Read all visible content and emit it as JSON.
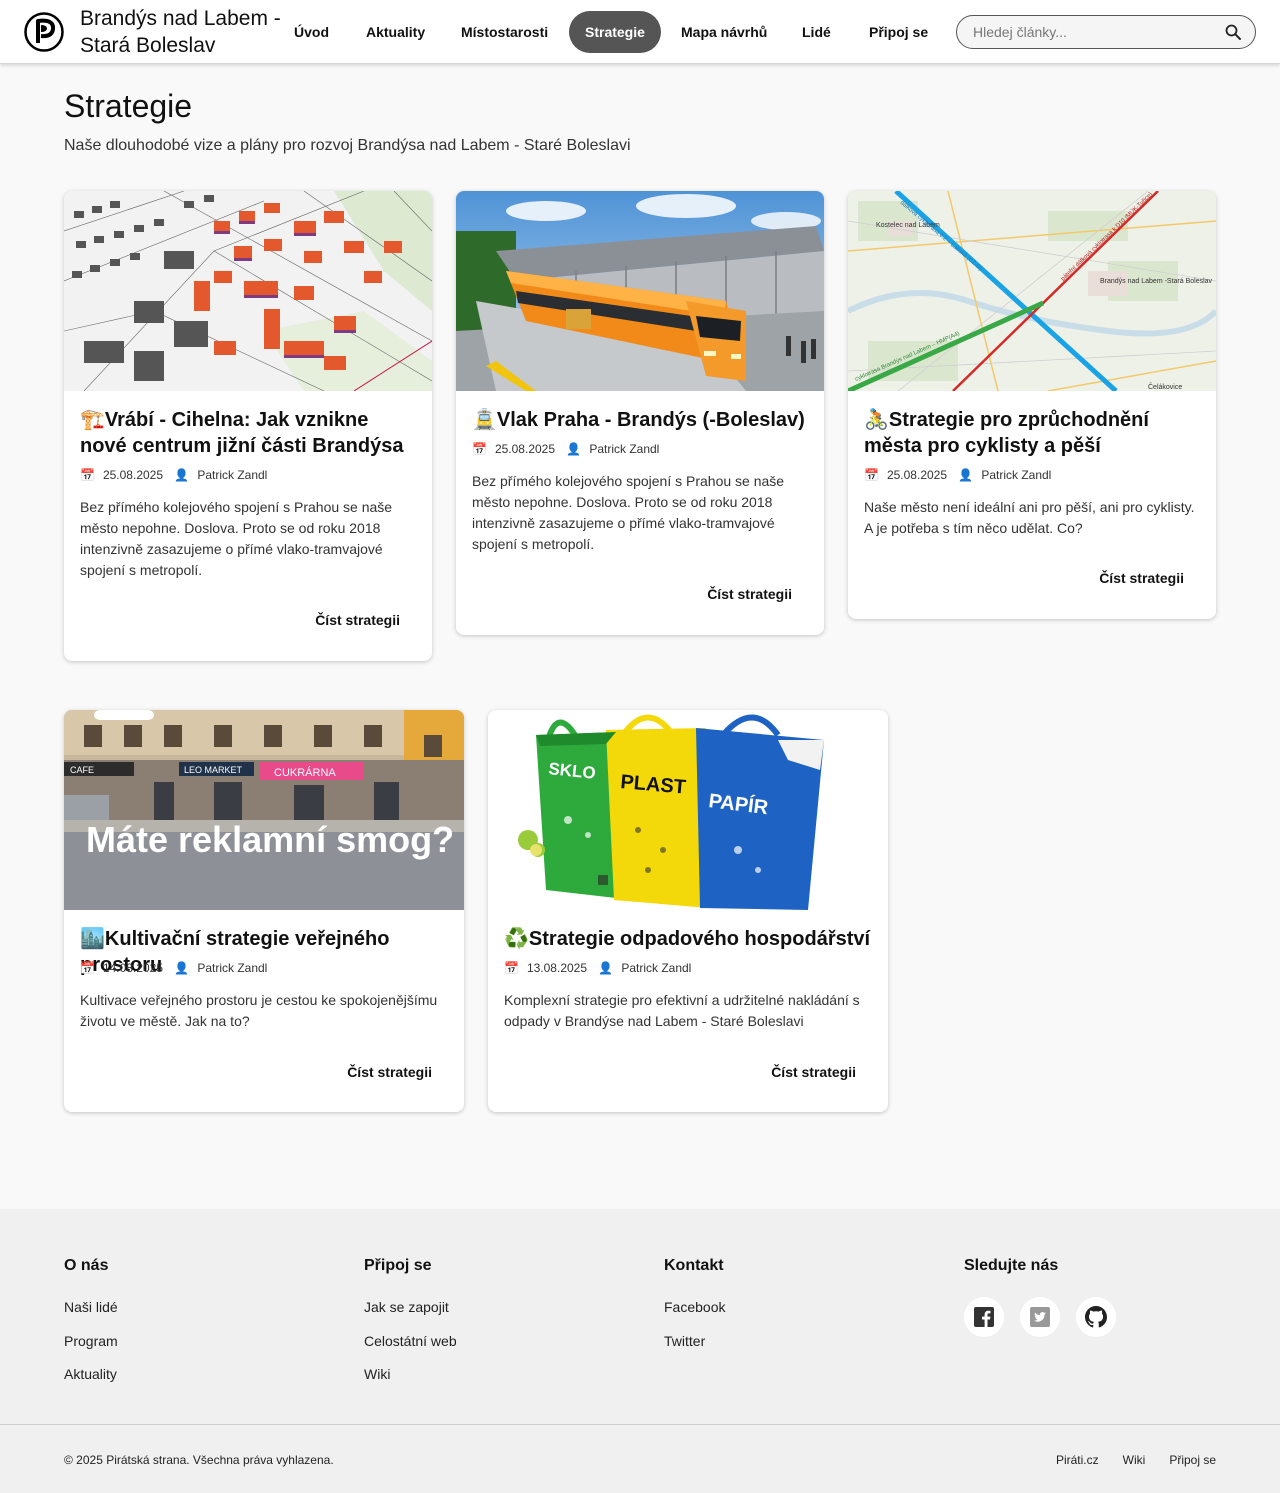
{
  "header": {
    "site_title": "Brandýs nad Labem - Stará Boleslav",
    "nav": [
      {
        "label": "Úvod"
      },
      {
        "label": "Aktuality"
      },
      {
        "label": "Místostarosti"
      },
      {
        "label": "Strategie",
        "active": true
      },
      {
        "label": "Mapa návrhů"
      },
      {
        "label": "Lidé"
      },
      {
        "label": "Připoj se"
      }
    ],
    "search": {
      "placeholder": "Hledej články...",
      "value": ""
    },
    "accent_color": "#555555"
  },
  "page": {
    "title": "Strategie",
    "subtitle": "Naše dlouhodobé vize a plány pro rozvoj Brandýsa nad Labem - Staré Boleslavi"
  },
  "cards": [
    {
      "icon": "🏗️",
      "title": "Vrábí - Cihelna: Jak vznikne nové centrum jižní části Brandýsa",
      "date": "25.08.2025",
      "author": "Patrick Zandl",
      "excerpt": "Bez přímého kolejového spojení s Prahou se naše město nepohne. Doslova. Proto se od roku 2018 intenzivně zasazujeme o přímé vlako-tramvajové spojení s metropolí.",
      "read_label": "Číst strategii",
      "image": "urban-plan-3d-image"
    },
    {
      "icon": "🚊",
      "title": "Vlak Praha - Brandýs (-Boleslav)",
      "date": "25.08.2025",
      "author": "Patrick Zandl",
      "excerpt": "Bez přímého kolejového spojení s Prahou se naše město nepohne. Doslova. Proto se od roku 2018 intenzivně zasazujeme o přímé vlako-tramvajové spojení s metropolí.",
      "read_label": "Číst strategii",
      "image": "train-station-image"
    },
    {
      "icon": "🚴",
      "title": "Strategie pro zprůchodnění města pro cyklisty a pěší",
      "date": "25.08.2025",
      "author": "Patrick Zandl",
      "excerpt": "Naše město není ideální ani pro pěší, ani pro cyklisty. A je potřeba s tím něco udělat. Co?",
      "read_label": "Číst strategii",
      "image": "cycling-map-image",
      "map_labels": [
        "dálková cyklotrasa č.2 – Labská (CZ-D)",
        "páteřní dálková cyklotrasa k D10 (MÚK-Tuřice)",
        "cyklotrasa Brandýs nad Labem – HMP(A4)",
        "Kostelec nad Labem",
        "Brandýs nad Labem -Stará Boleslav",
        "Čelákovice"
      ]
    },
    {
      "icon": "🏙️",
      "title": "Kultivační strategie veřejného prostoru",
      "date": "14.08.2025",
      "author": "Patrick Zandl",
      "excerpt": "Kultivace veřejného prostoru je cestou ke spokojenějšímu životu ve městě. Jak na to?",
      "read_label": "Číst strategii",
      "image": "street-facade-image",
      "overlay": "Máte reklamní smog?",
      "shop_signs": [
        "LEO MARKET",
        "CUKRÁRNA",
        "CAFE"
      ]
    },
    {
      "icon": "♻️",
      "title": "Strategie odpadového hospodářství",
      "date": "13.08.2025",
      "author": "Patrick Zandl",
      "excerpt": "Komplexní strategie pro efektivní a udržitelné nakládání s odpady v Brandýse nad Labem - Staré Boleslavi",
      "read_label": "Číst strategii",
      "image": "recycling-bags-image",
      "bags": [
        {
          "label": "SKLO",
          "color": "#2eaa3c"
        },
        {
          "label": "PLAST",
          "color": "#f4d90a"
        },
        {
          "label": "PAPÍR",
          "color": "#1e63c4"
        }
      ]
    }
  ],
  "footer": {
    "columns": [
      {
        "title": "O nás",
        "links": [
          "Naši lidé",
          "Program",
          "Aktuality"
        ]
      },
      {
        "title": "Připoj se",
        "links": [
          "Jak se zapojit",
          "Celostátní web",
          "Wiki"
        ]
      },
      {
        "title": "Kontakt",
        "links": [
          "Facebook",
          "Twitter"
        ]
      },
      {
        "title": "Sledujte nás",
        "social": [
          "facebook-icon",
          "twitter-icon",
          "github-icon"
        ]
      }
    ],
    "copyright": "© 2025 Pirátská strana. Všechna práva vyhlazena.",
    "bottom_links": [
      "Piráti.cz",
      "Wiki",
      "Připoj se"
    ]
  }
}
